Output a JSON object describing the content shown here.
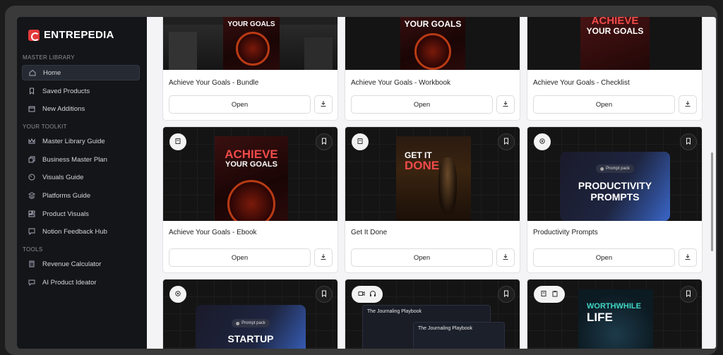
{
  "brand": {
    "name": "ENTREPEDIA"
  },
  "sidebar": {
    "sections": [
      {
        "title": "MASTER LIBRARY",
        "items": [
          {
            "label": "Home",
            "icon": "home-icon",
            "active": true
          },
          {
            "label": "Saved Products",
            "icon": "bookmark-icon"
          },
          {
            "label": "New Additions",
            "icon": "calendar-icon"
          }
        ]
      },
      {
        "title": "YOUR TOOLKIT",
        "items": [
          {
            "label": "Master Library Guide",
            "icon": "crown-icon"
          },
          {
            "label": "Business Master Plan",
            "icon": "copy-icon"
          },
          {
            "label": "Visuals Guide",
            "icon": "palette-icon"
          },
          {
            "label": "Platforms Guide",
            "icon": "layers-icon"
          },
          {
            "label": "Product Visuals",
            "icon": "gallery-icon"
          },
          {
            "label": "Notion Feedback Hub",
            "icon": "message-icon"
          }
        ]
      },
      {
        "title": "TOOLS",
        "items": [
          {
            "label": "Revenue Calculator",
            "icon": "calculator-icon"
          },
          {
            "label": "AI Product Ideator",
            "icon": "chat-icon"
          }
        ]
      }
    ]
  },
  "products": {
    "open_label": "Open",
    "row1": [
      {
        "title": "Achieve Your Goals - Bundle",
        "cover_text": "YOUR GOALS"
      },
      {
        "title": "Achieve Your Goals - Workbook",
        "cover_text": "YOUR GOALS"
      },
      {
        "title": "Achieve Your Goals - Checklist",
        "cover_red": "ACHIEVE",
        "cover_text": "YOUR GOALS"
      }
    ],
    "row2": [
      {
        "title": "Achieve Your Goals - Ebook",
        "cover_red": "ACHIEVE",
        "cover_text": "YOUR GOALS"
      },
      {
        "title": "Get It Done",
        "cover_white": "GET IT",
        "cover_red": "DONE"
      },
      {
        "title": "Productivity Prompts",
        "pill": "Prompt pack",
        "cover_text": "PRODUCTIVITY PROMPTS"
      }
    ],
    "row3": [
      {
        "pill": "Prompt pack",
        "cover_text": "STARTUP"
      },
      {
        "cover_text": "The Journaling Playbook",
        "cover_text_2": "The Journaling Playbook"
      },
      {
        "cover_teal": "WORTHWHILE",
        "cover_text": "LIFE"
      }
    ]
  },
  "colors": {
    "accent": "#e23a3a",
    "sidebar_bg": "#141518",
    "teal": "#3fd6c4"
  }
}
